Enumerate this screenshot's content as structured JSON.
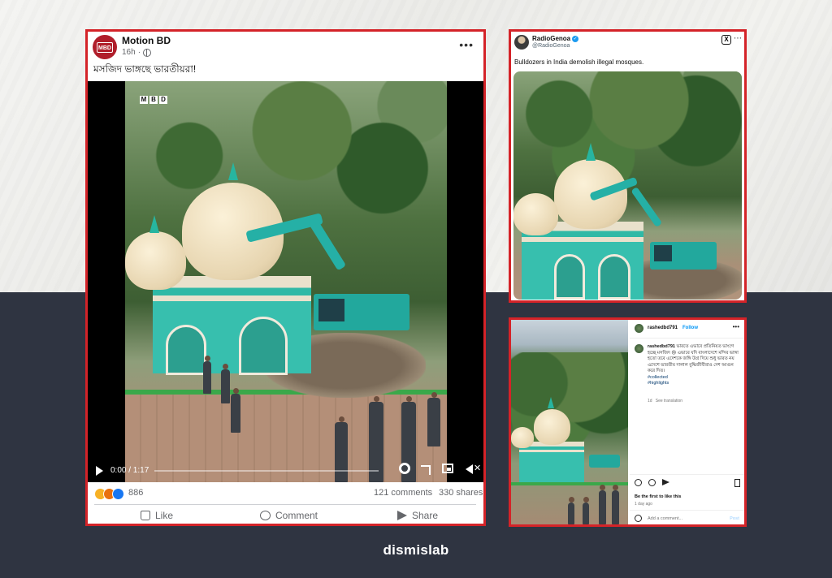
{
  "facebook_post": {
    "avatar_text": "MBD",
    "page_name": "Motion BD",
    "time": "16h",
    "caption": "মসজিদ ভাঙ্গছে ভারতীয়রা!",
    "video_watermark": [
      "M",
      "B",
      "D"
    ],
    "video_time": "0:00 / 1:17",
    "reaction_count": "886",
    "comments": "121 comments",
    "shares": "330 shares",
    "actions": {
      "like": "Like",
      "comment": "Comment",
      "share": "Share"
    },
    "reaction_colors": [
      "#f7b125",
      "#e9710f",
      "#1877f2"
    ]
  },
  "twitter_post": {
    "name": "RadioGenoa",
    "handle": "@RadioGenoa",
    "text": "Bulldozers in India demolish illegal mosques."
  },
  "instagram_post": {
    "username": "rashedbd791",
    "follow": "Follow",
    "caption_user": "rashedbd791",
    "caption_text": "ভারতে এভাবে প্রতিনিয়ত ভাংগে হচ্ছে মসজিদ 😢 এভাবে যদি বাংলাদেশে মন্দির ভাঙ্গা হতো তবে এদেশকে জঙ্গি উগ্র দিয়ে শুধু ভারত নয় এদেশে ভারতীয় দালাল বুদ্ধিজীবীরাও দেশ আগুন করে দিত।",
    "tags": [
      "#collected",
      "#highlights"
    ],
    "caption_time": "1d",
    "see_translation": "See translation",
    "likes_text": "Be the first to like this",
    "ago": "1 day ago",
    "add_comment": "Add a comment...",
    "post": "Post"
  },
  "footer": {
    "brand": "dismislab"
  }
}
